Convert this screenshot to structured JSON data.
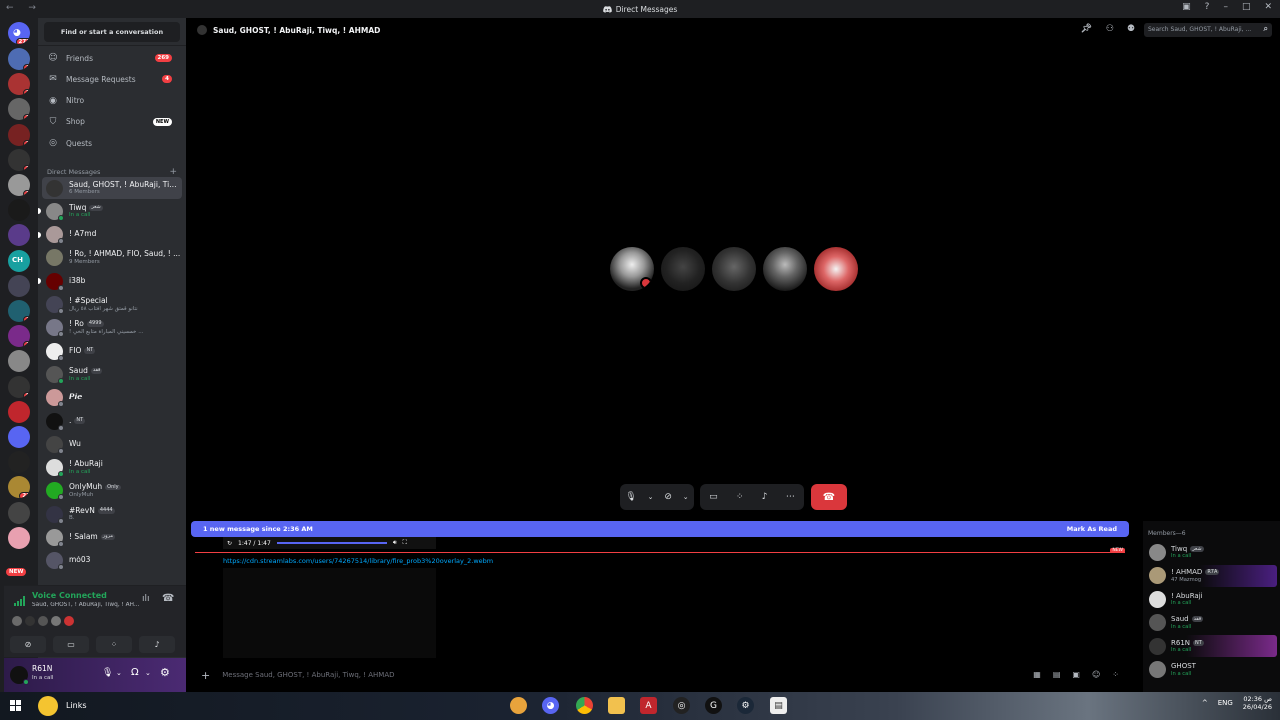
{
  "window": {
    "title": "Direct Messages"
  },
  "colors": {
    "accent": "#5865f2",
    "danger": "#da373c",
    "online": "#23a55a",
    "badge": "#f23f43"
  },
  "guilds": {
    "home_badge": "273",
    "items": [
      {
        "badge": "1"
      },
      {
        "badge": "3"
      },
      {
        "badge": "3"
      },
      {
        "badge": "2"
      },
      {
        "badge": "2"
      },
      {
        "badge": "3"
      },
      {
        "badge": ""
      },
      {
        "badge": ""
      },
      {
        "label": "CH",
        "badge": ""
      },
      {
        "badge": ""
      },
      {
        "badge": "1"
      },
      {
        "badge": "1"
      },
      {
        "badge": ""
      },
      {
        "badge": "5"
      },
      {
        "badge": ""
      },
      {
        "badge": ""
      },
      {
        "badge": ""
      },
      {
        "badge": "21"
      },
      {
        "badge": ""
      },
      {
        "badge": ""
      }
    ],
    "new_label": "NEW"
  },
  "sidebar": {
    "find_placeholder": "Find or start a conversation",
    "nav": [
      {
        "label": "Friends",
        "badge": "269",
        "icon": "friends-icon"
      },
      {
        "label": "Message Requests",
        "badge": "4",
        "icon": "envelope-icon"
      },
      {
        "label": "Nitro",
        "badge": "",
        "icon": "nitro-icon"
      },
      {
        "label": "Shop",
        "badge": "NEW",
        "icon": "shop-icon"
      },
      {
        "label": "Quests",
        "badge": "",
        "icon": "quests-icon"
      }
    ],
    "dm_header": "Direct Messages",
    "dms": [
      {
        "name": "Saud, GHOST, ! AbuRaji, Tiw...",
        "sub": "6 Members",
        "tag": "",
        "call": false
      },
      {
        "name": "Tiwq",
        "sub": "In a call",
        "tag": "شعر",
        "call": true
      },
      {
        "name": "! A7md",
        "sub": "",
        "tag": "",
        "call": false
      },
      {
        "name": "! Ro, ! AHMAD, FIO, Saud, ! ...",
        "sub": "9 Members",
        "tag": "",
        "call": false
      },
      {
        "name": "i38b",
        "sub": "",
        "tag": "",
        "call": false
      },
      {
        "name": "! #Special",
        "sub": "نتانو قمتق شهر افتاب ٥٨ ريال",
        "tag": "",
        "call": false
      },
      {
        "name": "! Ro",
        "sub": "! خمسيني المباراة متابع الخي ...",
        "tag": "4999",
        "call": false
      },
      {
        "name": "FIO",
        "sub": "",
        "tag": "NT",
        "call": false
      },
      {
        "name": "Saud",
        "sub": "In a call",
        "tag": "قفد",
        "call": true
      },
      {
        "name": "𝙋𝙞𝙚",
        "sub": "",
        "tag": "",
        "call": false
      },
      {
        "name": ".",
        "sub": "",
        "tag": "NT",
        "call": false
      },
      {
        "name": "Wu",
        "sub": "",
        "tag": "",
        "call": false
      },
      {
        "name": "! AbuRaji",
        "sub": "In a call",
        "tag": "",
        "call": true
      },
      {
        "name": "OnlyMuh",
        "sub": "OnlyMuh",
        "tag": "Only",
        "call": false
      },
      {
        "name": "#RevN",
        "sub": "B.",
        "tag": "4444",
        "call": false
      },
      {
        "name": "! Salam",
        "sub": "",
        "tag": "مرور",
        "call": false
      },
      {
        "name": "mó03",
        "sub": "",
        "tag": "",
        "call": false
      }
    ]
  },
  "voice": {
    "status": "Voice Connected",
    "channel": "Saud, GHOST, ! AbuRaji, Tiwq, ! AH..."
  },
  "user": {
    "name": "R61N",
    "status": "In a call"
  },
  "channel": {
    "title": "Saud, GHOST, ! AbuRaji, Tiwq, ! AHMAD",
    "search_placeholder": "Search Saud, GHOST, ! AbuRaji, ..."
  },
  "chat": {
    "new_message_banner": "1 new message since 2:36 AM",
    "mark_as_read": "Mark As Read",
    "media_time": "1:47 / 1:47",
    "new_tag": "NEW",
    "link": "https://cdn.streamlabs.com/users/74267514/library/fire_prob3%20overlay_2.webm",
    "composer_placeholder": "Message Saud, GHOST, ! AbuRaji, Tiwq, ! AHMAD"
  },
  "members": {
    "header": "Members—6",
    "items": [
      {
        "name": "Tiwq",
        "sub": "In a call",
        "tag": "شعر"
      },
      {
        "name": "! AHMAD",
        "sub": "47 Mazmog",
        "tag": "R7A"
      },
      {
        "name": "! AbuRaji",
        "sub": "In a call",
        "tag": ""
      },
      {
        "name": "Saud",
        "sub": "In a call",
        "tag": "قفد"
      },
      {
        "name": "R61N",
        "sub": "In a call",
        "tag": "NT"
      },
      {
        "name": "GHOST",
        "sub": "In a call",
        "tag": ""
      }
    ]
  },
  "taskbar": {
    "search_label": "Links",
    "lang": "ENG",
    "time": "02:36 ص",
    "date": "26/04/26"
  }
}
